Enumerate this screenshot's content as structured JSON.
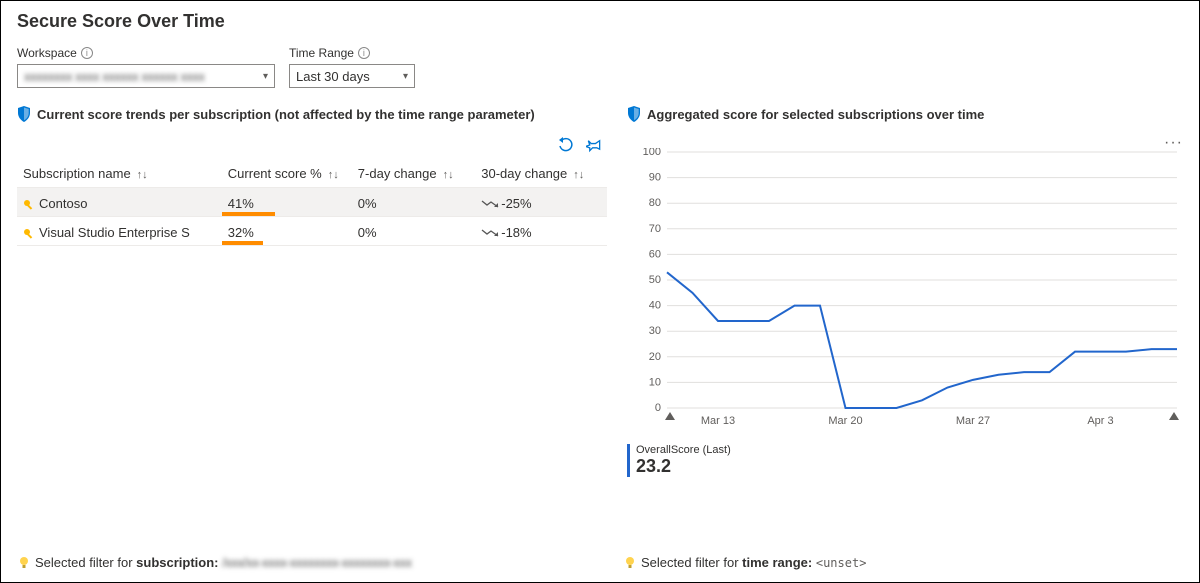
{
  "title": "Secure Score Over Time",
  "params": {
    "workspace": {
      "label": "Workspace",
      "value": "xxxxxxxx xxxx xxxxxx xxxxxx xxxx"
    },
    "timerange": {
      "label": "Time Range",
      "value": "Last 30 days"
    }
  },
  "left_panel": {
    "header": "Current score trends per subscription (not affected by the time range parameter)",
    "columns": [
      "Subscription name",
      "Current score %",
      "7-day change",
      "30-day change"
    ],
    "rows": [
      {
        "name": "Contoso",
        "score_pct": "41%",
        "bar_pct": 41,
        "d7": "0%",
        "d30": "-25%",
        "selected": true
      },
      {
        "name": "Visual Studio Enterprise S",
        "score_pct": "32%",
        "bar_pct": 32,
        "d7": "0%",
        "d30": "-18%",
        "selected": false
      }
    ]
  },
  "right_panel": {
    "header": "Aggregated score for selected subscriptions over time",
    "metric_label": "OverallScore (Last)",
    "metric_value": "23.2"
  },
  "chart_data": {
    "type": "line",
    "title": "Aggregated score for selected subscriptions over time",
    "xlabel": "",
    "ylabel": "",
    "ylim": [
      0,
      100
    ],
    "y_ticks": [
      0,
      10,
      20,
      30,
      40,
      50,
      60,
      70,
      80,
      90,
      100
    ],
    "x_tick_labels": [
      "Mar 13",
      "Mar 20",
      "Mar 27",
      "Apr 3"
    ],
    "x_tick_indices": [
      2,
      7,
      12,
      17
    ],
    "series": [
      {
        "name": "OverallScore",
        "color": "#2266cc",
        "x": [
          0,
          1,
          2,
          3,
          4,
          5,
          6,
          7,
          8,
          9,
          10,
          11,
          12,
          13,
          14,
          15,
          16,
          17,
          18,
          19,
          20
        ],
        "y": [
          53,
          45,
          34,
          34,
          34,
          40,
          40,
          0,
          0,
          0,
          3,
          8,
          11,
          13,
          14,
          14,
          22,
          22,
          22,
          23,
          23
        ]
      }
    ]
  },
  "footer": {
    "left_prefix": "Selected filter for ",
    "left_bold": "subscription:",
    "left_value": "/xxx/xx-xxxx-xxxxxxxx-xxxxxxxx-xxx",
    "right_prefix": "Selected filter for ",
    "right_bold": "time range:",
    "right_value": "<unset>"
  }
}
